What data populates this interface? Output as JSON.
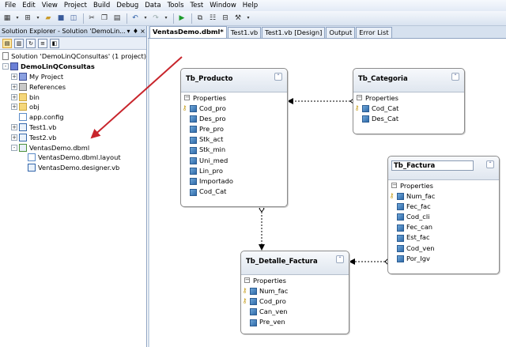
{
  "menu": [
    "File",
    "Edit",
    "View",
    "Project",
    "Build",
    "Debug",
    "Data",
    "Tools",
    "Test",
    "Window",
    "Help"
  ],
  "toolbar": {
    "icons": [
      "add-project-icon",
      "add-item-icon",
      "open-icon",
      "save-icon",
      "save-all-icon",
      "cut-icon",
      "copy-icon",
      "paste-icon",
      "undo-icon",
      "redo-icon",
      "start-icon",
      "solution-explorer-icon",
      "properties-icon",
      "object-browser-icon",
      "toolbox-icon"
    ]
  },
  "solution_explorer": {
    "title": "Solution Explorer - Solution 'DemoLin...",
    "pin": "♦",
    "close": "×",
    "items": [
      {
        "label": "Solution 'DemoLinQConsultas' (1 project)",
        "icon": "solution-icon",
        "expander": "",
        "level": 0
      },
      {
        "label": "DemoLinQConsultas",
        "icon": "project-icon",
        "expander": "-",
        "level": 0,
        "bold": true
      },
      {
        "label": "My Project",
        "icon": "my-project-icon",
        "expander": "+",
        "level": 1
      },
      {
        "label": "References",
        "icon": "references-icon",
        "expander": "+",
        "level": 1
      },
      {
        "label": "bin",
        "icon": "folder-icon",
        "expander": "+",
        "level": 1
      },
      {
        "label": "obj",
        "icon": "folder-icon",
        "expander": "+",
        "level": 1
      },
      {
        "label": "app.config",
        "icon": "config-file-icon",
        "expander": "",
        "level": 1
      },
      {
        "label": "Test1.vb",
        "icon": "vb-file-icon",
        "expander": "+",
        "level": 1
      },
      {
        "label": "Test2.vb",
        "icon": "vb-file-icon",
        "expander": "+",
        "level": 1
      },
      {
        "label": "VentasDemo.dbml",
        "icon": "dbml-file-icon",
        "expander": "-",
        "level": 1
      },
      {
        "label": "VentasDemo.dbml.layout",
        "icon": "file-icon",
        "expander": "",
        "level": 2
      },
      {
        "label": "VentasDemo.designer.vb",
        "icon": "vb-file-icon",
        "expander": "",
        "level": 2
      }
    ]
  },
  "tabs": [
    {
      "label": "VentasDemo.dbml*",
      "active": true
    },
    {
      "label": "Test1.vb",
      "active": false
    },
    {
      "label": "Test1.vb [Design]",
      "active": false
    },
    {
      "label": "Output",
      "active": false
    },
    {
      "label": "Error List",
      "active": false
    }
  ],
  "entities": {
    "producto": {
      "name": "Tb_Producto",
      "section": "Properties",
      "props": [
        "Cod_pro",
        "Des_pro",
        "Pre_pro",
        "Stk_act",
        "Stk_min",
        "Uni_med",
        "Lin_pro",
        "Importado",
        "Cod_Cat"
      ],
      "keys": [
        0
      ]
    },
    "categoria": {
      "name": "Tb_Categoria",
      "section": "Properties",
      "props": [
        "Cod_Cat",
        "Des_Cat"
      ],
      "keys": [
        0
      ]
    },
    "factura": {
      "name": "Tb_Factura",
      "section": "Properties",
      "props": [
        "Num_fac",
        "Fec_fac",
        "Cod_cli",
        "Fec_can",
        "Est_fac",
        "Cod_ven",
        "Por_Igv"
      ],
      "keys": [
        0
      ]
    },
    "detalle": {
      "name": "Tb_Detalle_Factura",
      "section": "Properties",
      "props": [
        "Num_fac",
        "Cod_pro",
        "Can_ven",
        "Pre_ven"
      ],
      "keys": [
        0,
        1
      ]
    }
  },
  "colors": {
    "annotation_arrow": "#c8252c",
    "accent": "#3b5998"
  }
}
